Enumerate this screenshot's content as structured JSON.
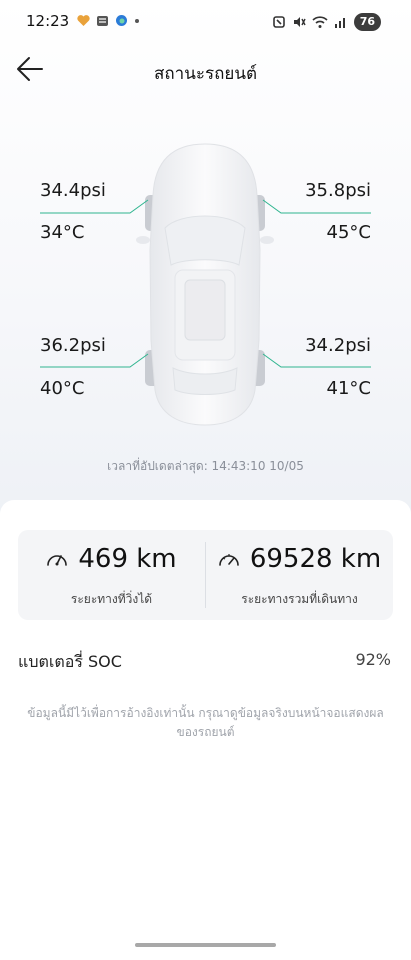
{
  "status_bar": {
    "time": "12:23",
    "battery": "76"
  },
  "header": {
    "title": "สถานะรถยนต์"
  },
  "tires": {
    "front_left": {
      "pressure": "34.4psi",
      "temp": "34°C"
    },
    "front_right": {
      "pressure": "35.8psi",
      "temp": "45°C"
    },
    "rear_left": {
      "pressure": "36.2psi",
      "temp": "40°C"
    },
    "rear_right": {
      "pressure": "34.2psi",
      "temp": "41°C"
    }
  },
  "update": {
    "text": "เวลาที่อัปเดตล่าสุด: 14:43:10 10/05"
  },
  "range": {
    "remaining_value": "469 km",
    "remaining_label": "ระยะทางที่วิ่งได้",
    "total_value": "69528 km",
    "total_label": "ระยะทางรวมที่เดินทาง"
  },
  "battery_soc": {
    "label": "แบตเตอรี่ SOC",
    "value": "92%"
  },
  "disclaimer": "ข้อมูลนี้มีไว้เพื่อการอ้างอิงเท่านั้น กรุณาดูข้อมูลจริงบนหน้าจอแสดงผลของรถยนต์",
  "colors": {
    "leader_line": "#2fb58f",
    "muted_text": "#8a8f99"
  },
  "icons": {
    "back": "arrow-left-icon",
    "speedometer": "speedometer-icon"
  }
}
